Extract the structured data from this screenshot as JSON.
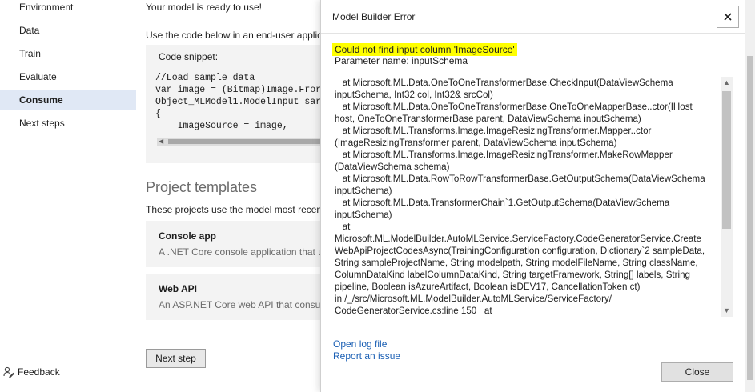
{
  "nav": {
    "items": [
      {
        "label": "Environment"
      },
      {
        "label": "Data"
      },
      {
        "label": "Train"
      },
      {
        "label": "Evaluate"
      },
      {
        "label": "Consume"
      },
      {
        "label": "Next steps"
      }
    ],
    "active_label": "Consume",
    "feedback_label": "Feedback"
  },
  "main": {
    "ready_text": "Your model is ready to use!",
    "use_code_text": "Use the code below in an end-user applic",
    "snippet_label": "Code snippet:",
    "code_text": "//Load sample data\nvar image = (Bitmap)Image.Fror\nObject_MLModel1.ModelInput sar\n{\n    ImageSource = image,",
    "project_templates_title": "Project templates",
    "project_templates_desc": "These projects use the model most recent",
    "cards": [
      {
        "title": "Console app",
        "desc": "A .NET Core console application that u"
      },
      {
        "title": "Web API",
        "desc": "An ASP.NET Core web API that consur"
      }
    ],
    "next_step_label": "Next step"
  },
  "dialog": {
    "title": "Model Builder Error",
    "error_message": "Could not find input column 'ImageSource'",
    "parameter_line": "Parameter name: inputSchema",
    "stack_trace": "   at Microsoft.ML.Data.OneToOneTransformerBase.CheckInput(DataViewSchema inputSchema, Int32 col, Int32& srcCol)\n   at Microsoft.ML.Data.OneToOneTransformerBase.OneToOneMapperBase..ctor(IHost host, OneToOneTransformerBase parent, DataViewSchema inputSchema)\n   at Microsoft.ML.Transforms.Image.ImageResizingTransformer.Mapper..ctor (ImageResizingTransformer parent, DataViewSchema inputSchema)\n   at Microsoft.ML.Transforms.Image.ImageResizingTransformer.MakeRowMapper (DataViewSchema schema)\n   at Microsoft.ML.Data.RowToRowTransformerBase.GetOutputSchema(DataViewSchema inputSchema)\n   at Microsoft.ML.Data.TransformerChain`1.GetOutputSchema(DataViewSchema inputSchema)\n   at\nMicrosoft.ML.ModelBuilder.AutoMLService.ServiceFactory.CodeGeneratorService.Create WebApiProjectCodesAsync(TrainingConfiguration configuration, Dictionary`2 sampleData, String sampleProjectName, String modelpath, String modelFileName, String className, ColumnDataKind labelColumnDataKind, String targetFramework, String[] labels, String pipeline, Boolean isAzureArtifact, Boolean isDEV17, CancellationToken ct)\nin /_/src/Microsoft.ML.ModelBuilder.AutoMLService/ServiceFactory/\nCodeGeneratorService.cs:line 150   at",
    "open_log_label": "Open log file",
    "report_issue_label": "Report an issue",
    "close_label": "Close"
  },
  "colors": {
    "highlight": "#ffff00",
    "link": "#1a5fb4",
    "active_nav_bg": "#e0e8f5"
  }
}
